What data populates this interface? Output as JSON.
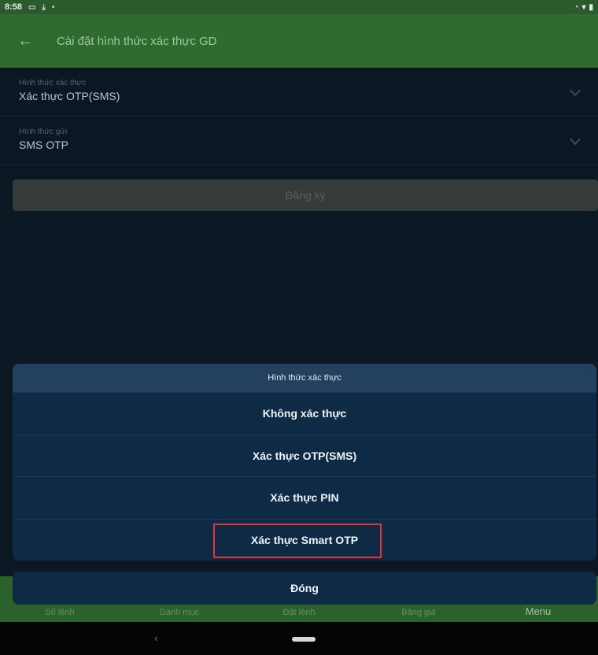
{
  "status_bar": {
    "time": "8:58"
  },
  "app_bar": {
    "title": "Cài đặt hình thức xác thực GD"
  },
  "form": {
    "auth_method": {
      "label": "Hình thức xác thực",
      "value": "Xác thực OTP(SMS)"
    },
    "send_method": {
      "label": "Hình thức gửi",
      "value": "SMS OTP"
    },
    "register_label": "Đăng ký"
  },
  "sheet": {
    "title": "Hình thức xác thực",
    "options": [
      "Không xác thực",
      "Xác thực OTP(SMS)",
      "Xác thực PIN",
      "Xác thực Smart OTP"
    ],
    "close_label": "Đóng"
  },
  "bottom_nav": {
    "items": [
      "Sổ lệnh",
      "Danh mục",
      "Đặt lệnh",
      "Bảng giá",
      "Menu"
    ]
  },
  "colors": {
    "accent": "#2f6a2f",
    "sheet": "#0f2a45",
    "highlight": "#e2353a"
  }
}
